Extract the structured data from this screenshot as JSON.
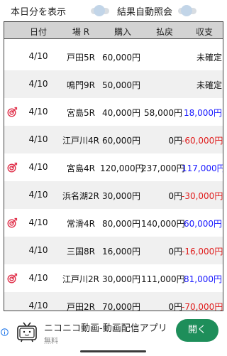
{
  "toggles": [
    {
      "label": "本日分を表示",
      "on": false
    },
    {
      "label": "結果自動照会",
      "on": false
    }
  ],
  "table": {
    "headers": [
      "日付",
      "場 R",
      "購入",
      "払戻",
      "収支"
    ],
    "rows": [
      {
        "date": "4/10",
        "venue": "戸田5R",
        "bet": "60,000円",
        "payout": "",
        "balance": "未確定",
        "hit": false,
        "balance_color": "#111111"
      },
      {
        "date": "4/10",
        "venue": "鳴門9R",
        "bet": "50,000円",
        "payout": "",
        "balance": "未確定",
        "hit": false,
        "balance_color": "#111111"
      },
      {
        "date": "4/10",
        "venue": "宮島5R",
        "bet": "40,000円",
        "payout": "58,000円",
        "balance": "18,000円",
        "hit": true,
        "balance_color": "#1a1aff"
      },
      {
        "date": "4/10",
        "venue": "江戸川4R",
        "bet": "60,000円",
        "payout": "0円",
        "balance": "-60,000円",
        "hit": false,
        "balance_color": "#e02020"
      },
      {
        "date": "4/10",
        "venue": "宮島4R",
        "bet": "120,000円",
        "payout": "237,000円",
        "balance": "117,000円",
        "hit": true,
        "balance_color": "#1a1aff"
      },
      {
        "date": "4/10",
        "venue": "浜名湖2R",
        "bet": "30,000円",
        "payout": "0円",
        "balance": "-30,000円",
        "hit": false,
        "balance_color": "#e02020"
      },
      {
        "date": "4/10",
        "venue": "常滑4R",
        "bet": "80,000円",
        "payout": "140,000円",
        "balance": "60,000円",
        "hit": true,
        "balance_color": "#1a1aff"
      },
      {
        "date": "4/10",
        "venue": "三国8R",
        "bet": "16,000円",
        "payout": "0円",
        "balance": "-16,000円",
        "hit": false,
        "balance_color": "#e02020"
      },
      {
        "date": "4/10",
        "venue": "江戸川2R",
        "bet": "30,000円",
        "payout": "111,000円",
        "balance": "81,000円",
        "hit": true,
        "balance_color": "#1a1aff"
      },
      {
        "date": "4/10",
        "venue": "戸田2R",
        "bet": "70,000円",
        "payout": "0円",
        "balance": "-70,000円",
        "hit": false,
        "balance_color": "#e02020"
      }
    ]
  },
  "ad": {
    "title": "ニコニコ動画-動画配信アプリ",
    "subtitle": "無料",
    "button": "開く",
    "icon": "niconico-tv-icon"
  },
  "colors": {
    "hit_icon": "#e0304a",
    "positive": "#1a1aff",
    "negative": "#e02020",
    "ad_button": "#1e8e5a"
  }
}
